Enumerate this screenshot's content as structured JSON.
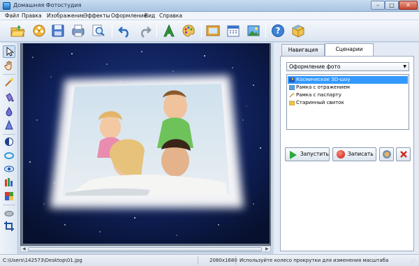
{
  "window": {
    "title": "Домашняя Фотостудия",
    "min": "–",
    "max": "□",
    "close": "✕"
  },
  "menu": [
    "Файл",
    "Правка",
    "Изображение",
    "Эффекты",
    "Оформление",
    "Вид",
    "Справка"
  ],
  "toolbar": {
    "icons": [
      "open-folder-icon",
      "film-reel-icon",
      "save-icon",
      "print-icon",
      "zoom-icon",
      "undo-icon",
      "redo-icon",
      "text-icon",
      "palette-icon",
      "frame-icon",
      "calendar-icon",
      "picture-icon",
      "help-icon",
      "box-icon"
    ]
  },
  "left_tools": [
    "pointer-icon",
    "hand-icon",
    "magic-wand-icon",
    "bucket-icon",
    "drop-icon",
    "cone-icon",
    "eclipse-icon",
    "ring-icon",
    "eye-icon",
    "color-chart-icon",
    "color-blocks-icon",
    "eraser-icon",
    "crop-icon"
  ],
  "right_panel": {
    "tabs": [
      "Навигация",
      "Сценарии"
    ],
    "active_tab": "Сценарии",
    "dropdown": "Оформление фото",
    "scenarios": [
      {
        "label": "Космическое 3D-шоу",
        "selected": true
      },
      {
        "label": "Рамка с отражением",
        "selected": false
      },
      {
        "label": "Рамка с паспарту",
        "selected": false
      },
      {
        "label": "Старинный свиток",
        "selected": false
      }
    ],
    "buttons": {
      "run": "Запустить",
      "record": "Записать"
    }
  },
  "status": {
    "path": "C:\\Users\\142573\\Desktop\\01.jpg",
    "size": "2080x1680",
    "hint": "Используйте колесо прокрутки для изменения масштаба"
  },
  "colors": {
    "accent": "#3399ff",
    "sky": "#0c1a44",
    "glow": "#ffffff"
  }
}
